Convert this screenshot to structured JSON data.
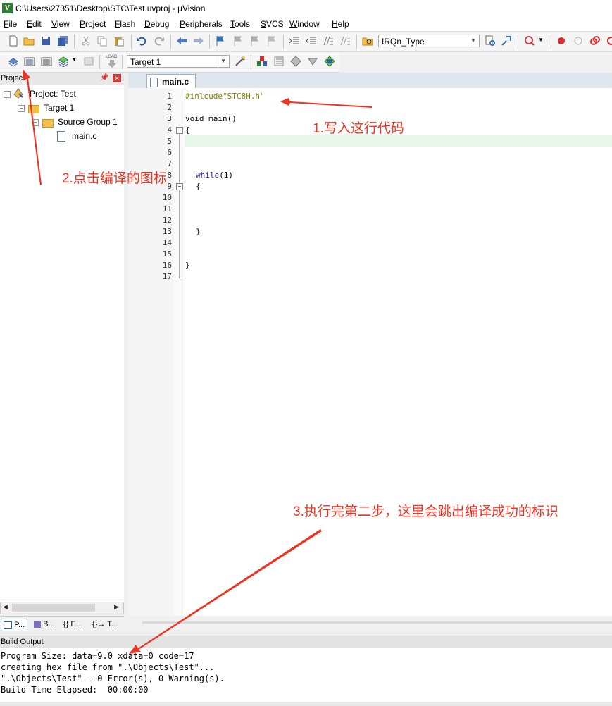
{
  "window": {
    "title": "C:\\Users\\27351\\Desktop\\STC\\Test.uvproj - µVision",
    "app_icon": "V"
  },
  "menu": [
    "File",
    "Edit",
    "View",
    "Project",
    "Flash",
    "Debug",
    "Peripherals",
    "Tools",
    "SVCS",
    "Window",
    "Help"
  ],
  "toolbar1": {
    "find_combo_value": "IRQn_Type"
  },
  "toolbar2": {
    "target_combo_value": "Target 1",
    "load_label": "LOAD"
  },
  "project_panel": {
    "title": "Project",
    "tree": {
      "project": "Project: Test",
      "target": "Target 1",
      "group": "Source Group 1",
      "file": "main.c"
    },
    "tabs": [
      "P...",
      "B...",
      "{} F...",
      "{}→ T..."
    ]
  },
  "editor": {
    "tab": "main.c",
    "line_numbers": [
      "1",
      "2",
      "3",
      "4",
      "5",
      "6",
      "7",
      "8",
      "9",
      "10",
      "11",
      "12",
      "13",
      "14",
      "15",
      "16",
      "17"
    ],
    "code": {
      "l1": "#inlcude\"STC8H.h\"",
      "l3": "void main()",
      "l4": "{",
      "l8_kw": "while",
      "l8_rest": "(1)",
      "l9": "{",
      "l13": "}",
      "l16": "}"
    }
  },
  "build_output": {
    "title": "Build Output",
    "lines": [
      "Program Size: data=9.0 xdata=0 code=17",
      "creating hex file from \".\\Objects\\Test\"...",
      "\".\\Objects\\Test\" - 0 Error(s), 0 Warning(s).",
      "Build Time Elapsed:  00:00:00"
    ]
  },
  "annotations": {
    "step1": "1.写入这行代码",
    "step2": "2.点击编译的图标",
    "step3": "3.执行完第二步，这里会跳出编译成功的标识",
    "color": "#ee3322"
  },
  "colors": {
    "string": "#a31515",
    "keyword": "#1c1ca8",
    "preprocessor": "#808000",
    "highlight": "#e8f8e8"
  }
}
